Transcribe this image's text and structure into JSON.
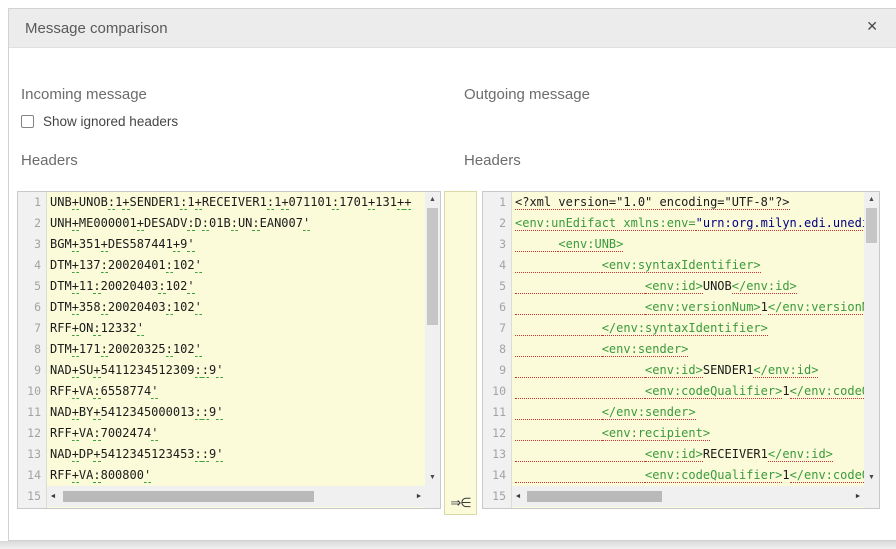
{
  "dialog": {
    "title": "Message comparison"
  },
  "icons": {
    "close": "✕",
    "merge": "⇒∈",
    "up": "▲",
    "down": "▼",
    "left": "◄",
    "right": "►"
  },
  "colors": {
    "panel_background": "#fbfbda",
    "xml_tag": "#3b9a3b",
    "xml_attr_value": "#000080",
    "diff_underline_incoming": "#3ca03c",
    "diff_underline_outgoing": "#cc3333",
    "titlebar_background": "#ececec"
  },
  "incoming": {
    "section_title": "Incoming message",
    "checkbox_label": "Show ignored headers",
    "checkbox_checked": false,
    "headers_label": "Headers",
    "editor": {
      "language": "edifact",
      "line_count": 15,
      "lines": [
        "UNB+UNOB:1+SENDER1:1+RECEIVER1:1+071101:1701+131++",
        "UNH+ME000001+DESADV:D:01B:UN:EAN007'",
        "BGM+351+DES587441+9'",
        "DTM+137:20020401:102'",
        "DTM+11:20020403:102'",
        "DTM+358:20020403:102'",
        "RFF+ON:12332'",
        "DTM+171:20020325:102'",
        "NAD+SU+5411234512309::9'",
        "RFF+VA:6558774'",
        "NAD+BY+5412345000013::9'",
        "RFF+VA:7002474'",
        "NAD+DP+5412345123453::9'",
        "RFF+VA:800800'"
      ]
    }
  },
  "outgoing": {
    "section_title": "Outgoing message",
    "headers_label": "Headers",
    "editor": {
      "language": "xml",
      "line_count": 15,
      "lines": [
        [
          {
            "c": "decl",
            "v": "<?xml version=\"1.0\" encoding=\"UTF-8\"?>"
          }
        ],
        [
          {
            "c": "tag",
            "v": "<env:unEdifact xmlns:env="
          },
          {
            "c": "val",
            "v": "\"urn:org.milyn.edi.unedi"
          }
        ],
        [
          {
            "c": "ws",
            "v": "      "
          },
          {
            "c": "tag",
            "v": "<env:UNB>"
          }
        ],
        [
          {
            "c": "ws",
            "v": "            "
          },
          {
            "c": "tag",
            "v": "<env:syntaxIdentifier>"
          }
        ],
        [
          {
            "c": "ws",
            "v": "                  "
          },
          {
            "c": "tag",
            "v": "<env:id>"
          },
          {
            "c": "txt",
            "v": "UNOB"
          },
          {
            "c": "tag",
            "v": "</env:id>"
          }
        ],
        [
          {
            "c": "ws",
            "v": "                  "
          },
          {
            "c": "tag",
            "v": "<env:versionNum>"
          },
          {
            "c": "txt",
            "v": "1"
          },
          {
            "c": "tag",
            "v": "</env:versionNum>"
          }
        ],
        [
          {
            "c": "ws",
            "v": "            "
          },
          {
            "c": "tag",
            "v": "</env:syntaxIdentifier>"
          }
        ],
        [
          {
            "c": "ws",
            "v": "            "
          },
          {
            "c": "tag",
            "v": "<env:sender>"
          }
        ],
        [
          {
            "c": "ws",
            "v": "                  "
          },
          {
            "c": "tag",
            "v": "<env:id>"
          },
          {
            "c": "txt",
            "v": "SENDER1"
          },
          {
            "c": "tag",
            "v": "</env:id>"
          }
        ],
        [
          {
            "c": "ws",
            "v": "                  "
          },
          {
            "c": "tag",
            "v": "<env:codeQualifier>"
          },
          {
            "c": "txt",
            "v": "1"
          },
          {
            "c": "tag",
            "v": "</env:codeQualifier>"
          }
        ],
        [
          {
            "c": "ws",
            "v": "            "
          },
          {
            "c": "tag",
            "v": "</env:sender>"
          }
        ],
        [
          {
            "c": "ws",
            "v": "            "
          },
          {
            "c": "tag",
            "v": "<env:recipient>"
          }
        ],
        [
          {
            "c": "ws",
            "v": "                  "
          },
          {
            "c": "tag",
            "v": "<env:id>"
          },
          {
            "c": "txt",
            "v": "RECEIVER1"
          },
          {
            "c": "tag",
            "v": "</env:id>"
          }
        ],
        [
          {
            "c": "ws",
            "v": "                  "
          },
          {
            "c": "tag",
            "v": "<env:codeQualifier>"
          },
          {
            "c": "txt",
            "v": "1"
          },
          {
            "c": "tag",
            "v": "</env:codeQualifier>"
          }
        ]
      ]
    }
  }
}
